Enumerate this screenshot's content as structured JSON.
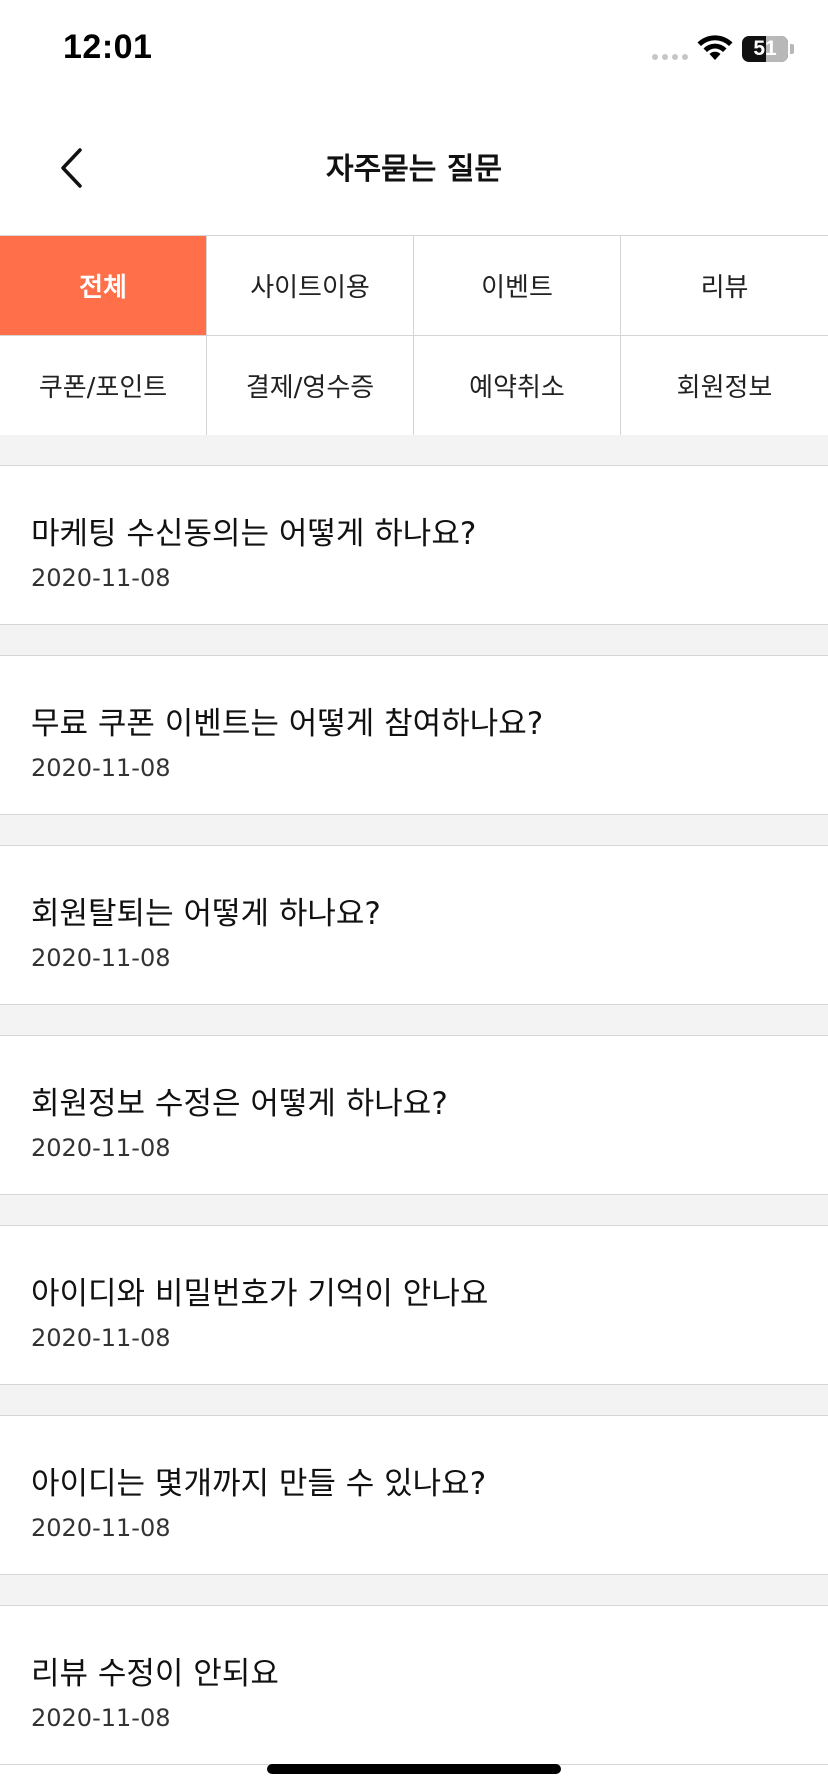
{
  "status_bar": {
    "time": "12:01",
    "battery": "51"
  },
  "header": {
    "title": "자주묻는 질문",
    "back_icon": "chevron-left-icon"
  },
  "categories": [
    {
      "label": "전체",
      "active": true
    },
    {
      "label": "사이트이용",
      "active": false
    },
    {
      "label": "이벤트",
      "active": false
    },
    {
      "label": "리뷰",
      "active": false
    },
    {
      "label": "쿠폰/포인트",
      "active": false
    },
    {
      "label": "결제/영수증",
      "active": false
    },
    {
      "label": "예약취소",
      "active": false
    },
    {
      "label": "회원정보",
      "active": false
    }
  ],
  "faqs": [
    {
      "question": "마케팅 수신동의는 어떻게 하나요?",
      "date": "2020-11-08"
    },
    {
      "question": "무료 쿠폰 이벤트는 어떻게 참여하나요?",
      "date": "2020-11-08"
    },
    {
      "question": "회원탈퇴는 어떻게 하나요?",
      "date": "2020-11-08"
    },
    {
      "question": "회원정보 수정은 어떻게 하나요?",
      "date": "2020-11-08"
    },
    {
      "question": "아이디와 비밀번호가 기억이 안나요",
      "date": "2020-11-08"
    },
    {
      "question": "아이디는 몇개까지 만들 수 있나요?",
      "date": "2020-11-08"
    },
    {
      "question": "리뷰 수정이 안되요",
      "date": "2020-11-08"
    }
  ],
  "colors": {
    "accent": "#ff6f4a",
    "divider": "#d4d4d4",
    "section_bg": "#f3f3f3"
  }
}
